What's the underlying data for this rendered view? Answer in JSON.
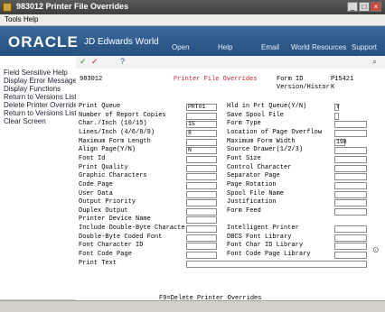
{
  "window": {
    "title": "983012    Printer File Overrides",
    "minimize": "_",
    "maximize": "□",
    "close": "×"
  },
  "menu": {
    "tools": "Tools",
    "help": "Help"
  },
  "banner": {
    "logo": "ORACLE",
    "product": "JD Edwards World",
    "links": [
      "Open",
      "Help",
      "Email",
      "World Resources",
      "Support"
    ]
  },
  "toolbar": {
    "ok": "✓",
    "cancel": "✓",
    "help": "?",
    "zoom": "⌕"
  },
  "leftnav": [
    "Field Sensitive Help",
    "Display Error Message",
    "Display Functions",
    "Return to Versions List",
    "Delete Printer Override",
    "Return to Versions List\\",
    "Clear Screen"
  ],
  "header": {
    "program": "983012",
    "title": "Printer File Overrides",
    "form_id_label": "Form ID",
    "form_id": "P15421",
    "version_label": "Version/Histor",
    "version": "K"
  },
  "left_fields": [
    {
      "label": "Print Queue",
      "value": "PRT01"
    },
    {
      "label": "Number of Report Copies",
      "value": ""
    },
    {
      "label": "Char./Inch (10/15)",
      "value": "15"
    },
    {
      "label": "Lines/Inch (4/6/8/9)",
      "value": "8"
    },
    {
      "label": "Maximum Form Length",
      "value": ""
    },
    {
      "label": "Align Page(Y/N)",
      "value": "N"
    },
    {
      "label": "Font Id",
      "value": ""
    },
    {
      "label": "Print Quality",
      "value": ""
    },
    {
      "label": "Graphic Characters",
      "value": ""
    },
    {
      "label": "Code Page",
      "value": ""
    },
    {
      "label": "User Data",
      "value": ""
    },
    {
      "label": "Output Priority",
      "value": ""
    },
    {
      "label": "Duplex Output",
      "value": ""
    },
    {
      "label": "Printer Device Name",
      "value": ""
    },
    {
      "label": "Include Double-Byte Characte",
      "value": ""
    },
    {
      "label": "Double-Byte Coded Font",
      "value": ""
    },
    {
      "label": "Font Character ID",
      "value": ""
    },
    {
      "label": "Font Code Page",
      "value": ""
    },
    {
      "label": "Print Text",
      "value": ""
    }
  ],
  "right_fields": [
    {
      "label": "Hld in Prt Queue(Y/N)",
      "value": "Y"
    },
    {
      "label": "Save Spool File",
      "value": ""
    },
    {
      "label": "Form Type",
      "value": ""
    },
    {
      "label": "Location of Page Overflow",
      "value": ""
    },
    {
      "label": "Maximum Form Width",
      "value": "198"
    },
    {
      "label": "Source Drawer(1/2/3)",
      "value": ""
    },
    {
      "label": "Font Size",
      "value": ""
    },
    {
      "label": "Control Character",
      "value": ""
    },
    {
      "label": "Separator Page",
      "value": ""
    },
    {
      "label": "Page Rotation",
      "value": ""
    },
    {
      "label": "Spool File Name",
      "value": ""
    },
    {
      "label": "Justification",
      "value": ""
    },
    {
      "label": "Form Feed",
      "value": ""
    },
    {
      "label": "",
      "value": ""
    },
    {
      "label": "Intelligent Printer",
      "value": ""
    },
    {
      "label": "DBCS Font Library",
      "value": ""
    },
    {
      "label": "Font Char ID Library",
      "value": ""
    },
    {
      "label": "Font Code Page Library",
      "value": ""
    }
  ],
  "footer": {
    "function_key": "F9=Delete Printer Overrides"
  }
}
